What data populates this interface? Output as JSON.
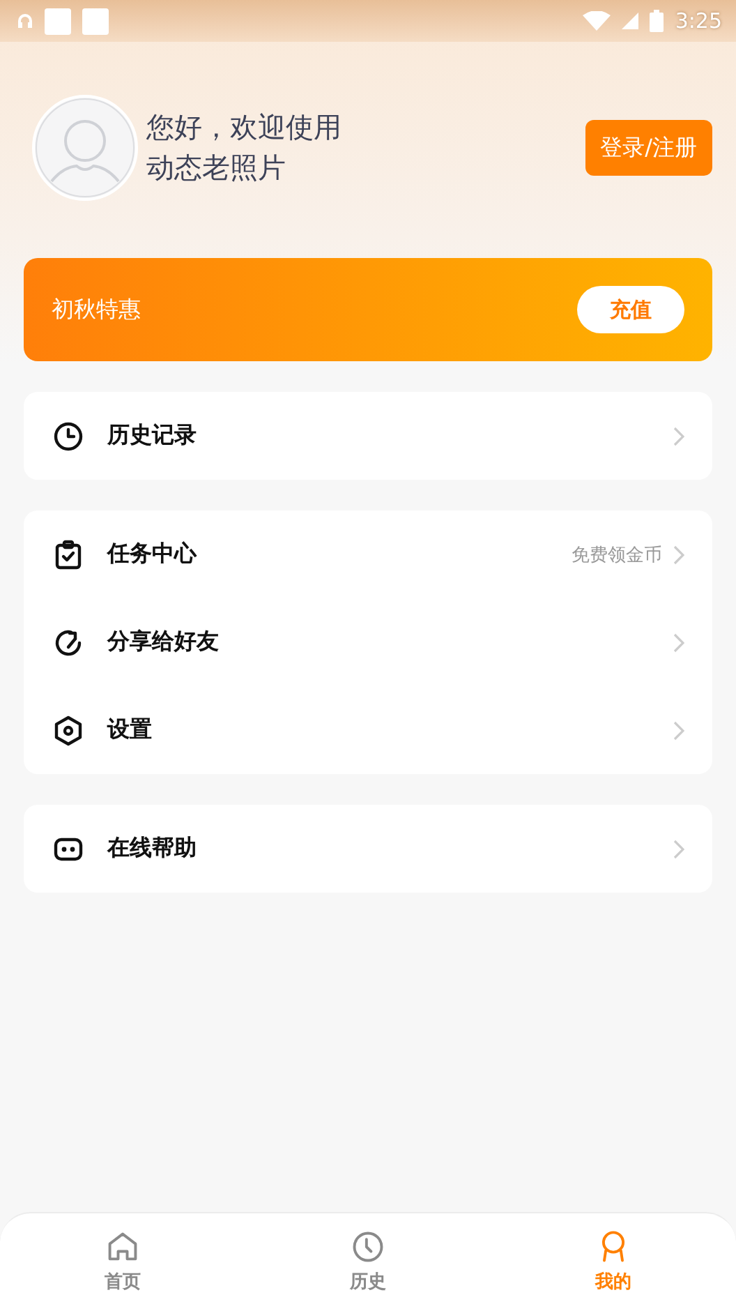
{
  "status_bar": {
    "time": "3:25"
  },
  "profile": {
    "greeting": "您好，欢迎使用",
    "app_name": "动态老照片",
    "login_button": "登录/注册"
  },
  "promo": {
    "title": "初秋特惠",
    "button": "充值"
  },
  "menu_groups": [
    {
      "items": [
        {
          "kind": "history",
          "label": "历史记录"
        }
      ]
    },
    {
      "items": [
        {
          "kind": "tasks",
          "label": "任务中心",
          "hint": "免费领金币"
        },
        {
          "kind": "share",
          "label": "分享给好友"
        },
        {
          "kind": "settings",
          "label": "设置"
        }
      ]
    },
    {
      "items": [
        {
          "kind": "help",
          "label": "在线帮助"
        }
      ]
    }
  ],
  "tabs": [
    {
      "kind": "home",
      "label": "首页",
      "selected": false
    },
    {
      "kind": "history",
      "label": "历史",
      "selected": false
    },
    {
      "kind": "mine",
      "label": "我的",
      "selected": true
    }
  ]
}
